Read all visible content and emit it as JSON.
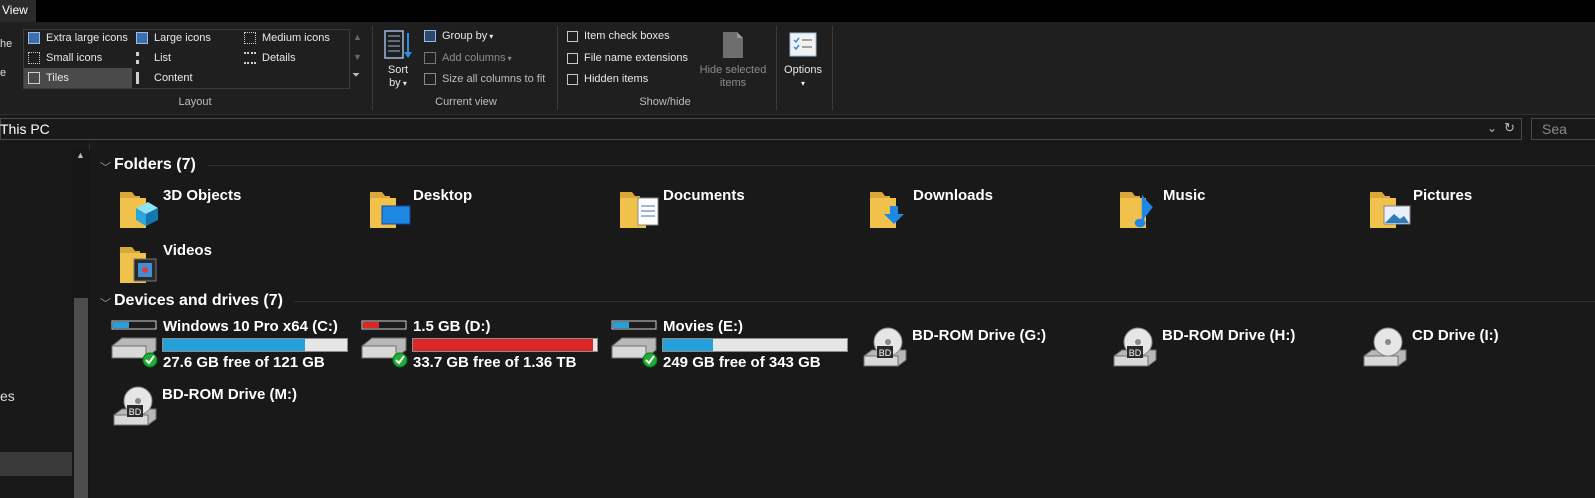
{
  "tabs": {
    "view": "View"
  },
  "nav_fragments": {
    "top1": "he",
    "top2": "e",
    "bottom": "es"
  },
  "ribbon": {
    "layout": {
      "label": "Layout",
      "items": [
        "Extra large icons",
        "Large icons",
        "Medium icons",
        "Small icons",
        "List",
        "Details",
        "Tiles",
        "Content"
      ],
      "selected": "Tiles"
    },
    "current_view": {
      "label": "Current view",
      "sort_by": "Sort\nby",
      "sort_line1": "Sort",
      "sort_line2": "by",
      "group_by": "Group by",
      "add_columns": "Add columns",
      "size_columns": "Size all columns to fit"
    },
    "show_hide": {
      "label": "Show/hide",
      "item_check_boxes": "Item check boxes",
      "file_name_extensions": "File name extensions",
      "hidden_items": "Hidden items",
      "hide_selected_line1": "Hide selected",
      "hide_selected_line2": "items"
    },
    "options": {
      "label": "Options"
    }
  },
  "address": {
    "path": "This PC",
    "search_placeholder": "Sea"
  },
  "folders": {
    "header": "Folders (7)",
    "items": [
      "3D Objects",
      "Desktop",
      "Documents",
      "Downloads",
      "Music",
      "Pictures",
      "Videos"
    ]
  },
  "drives": {
    "header": "Devices and drives (7)",
    "items": [
      {
        "name": "Windows 10 Pro x64  (C:)",
        "free": "27.6 GB free of 121 GB",
        "used_fraction": 0.77,
        "color": "#26a0da"
      },
      {
        "name": "1.5 GB (D:)",
        "free": "33.7 GB free of 1.36 TB",
        "used_fraction": 0.976,
        "color": "#da2626"
      },
      {
        "name": "Movies (E:)",
        "free": "249 GB free of 343 GB",
        "used_fraction": 0.274,
        "color": "#26a0da"
      }
    ],
    "optical": [
      "BD-ROM Drive (G:)",
      "BD-ROM Drive (H:)",
      "CD Drive (I:)",
      "BD-ROM Drive (M:)"
    ],
    "optical_badges": {
      "bd": "BD"
    }
  },
  "colors": {
    "accent": "#26a0da",
    "warning": "#da2626",
    "folder": "#f0c24b",
    "check": "#1fae33"
  }
}
